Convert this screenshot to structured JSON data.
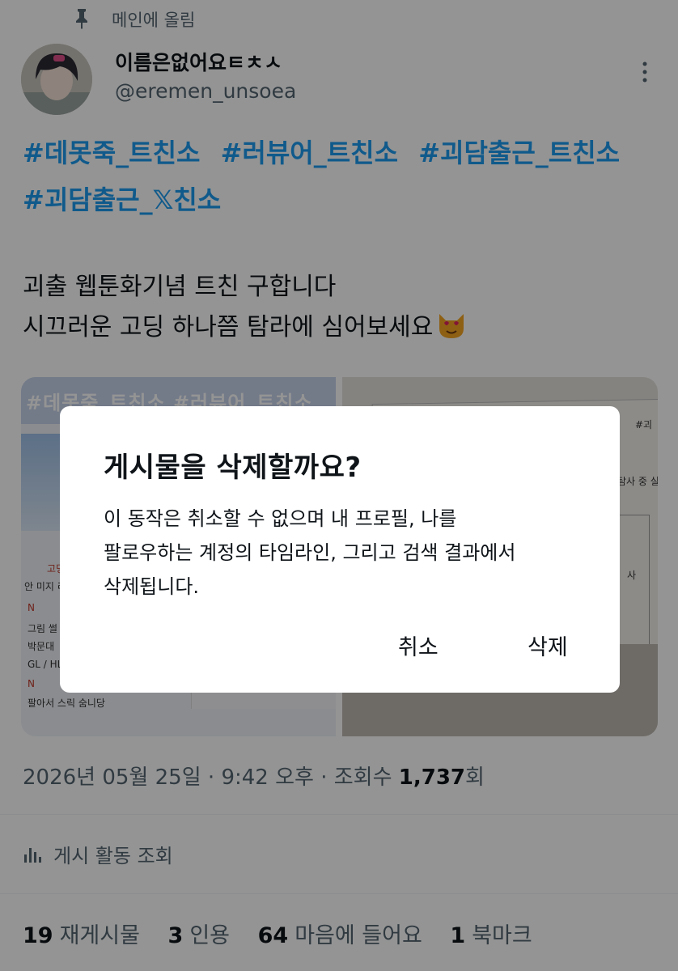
{
  "pinned": {
    "label": "메인에 올림",
    "icon": "pin-icon"
  },
  "author": {
    "display_name": "이름은없어요ㅌㅊㅅ",
    "handle": "@eremen_unsoea"
  },
  "hashtags": [
    "#데못죽_트친소",
    "#러뷰어_트친소",
    "#괴담출근_트친소",
    "#괴담출근_𝕏친소"
  ],
  "body": {
    "line1": "괴출 웹툰화기념 트친 구합니다",
    "line2": "시끄러운 고딩 하나쯤 탐라에 심어보세요"
  },
  "media": {
    "left_banner": "#데못죽_트친소 #러뷰어_트친소",
    "left_label": "고딩",
    "left_notes": [
      "안 미지 리뷰",
      "N",
      "그림 썰",
      "박문대",
      "GL / HL",
      "N",
      "팔아서 스릭 숨니당"
    ],
    "right_notes": [
      "#괴",
      "탐사 중 실행",
      "사"
    ]
  },
  "meta": {
    "date": "2026년 05월 25일",
    "time": "9:42 오후",
    "views_label": "조회수",
    "views_count": "1,737",
    "views_suffix": "회"
  },
  "activity": {
    "label": "게시 활동 조회",
    "icon": "bar-chart-icon"
  },
  "stats": {
    "reposts_count": "19",
    "reposts_label": "재게시물",
    "quotes_count": "3",
    "quotes_label": "인용",
    "likes_count": "64",
    "likes_label": "마음에 들어요",
    "bookmarks_count": "1",
    "bookmarks_label": "북마크"
  },
  "dialog": {
    "title": "게시물을 삭제할까요?",
    "message_line1": "이 동작은 취소할 수 없으며 내 프로필, 나를",
    "message_line2": "팔로우하는 계정의 타임라인, 그리고 검색 결과에서",
    "message_line3": "삭제됩니다.",
    "cancel_label": "취소",
    "delete_label": "삭제"
  },
  "colors": {
    "link": "#1d9bf0",
    "text": "#0f1419",
    "secondary": "#536471",
    "overlay": "rgba(0,0,0,0.42)"
  }
}
